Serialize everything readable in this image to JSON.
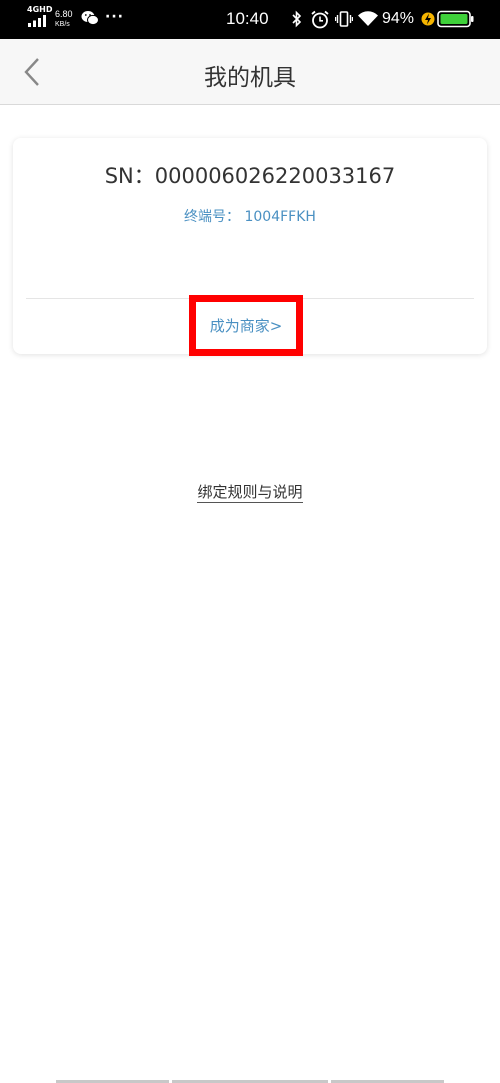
{
  "status_bar": {
    "network": "4GHD",
    "speed_value": "6.80",
    "speed_unit": "KB/s",
    "more": "···",
    "time": "10:40",
    "battery_percent": "94%"
  },
  "header": {
    "title": "我的机具"
  },
  "device": {
    "sn": "SN：000006026220033167",
    "terminal": "终端号： 1004FFKH",
    "become_merchant": "成为商家>"
  },
  "rules_link": "绑定规则与说明",
  "colors": {
    "accent_blue": "#4a90c2",
    "highlight_red": "#ff0000",
    "battery_green": "#3fd13a",
    "charging_yellow": "#f5b400"
  }
}
